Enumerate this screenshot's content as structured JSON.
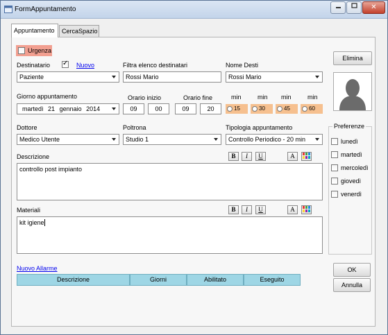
{
  "window": {
    "title": "FormAppuntamento"
  },
  "tabs": [
    "Appuntamento",
    "CercaSpazio"
  ],
  "urgenza": {
    "label": "Urgenza",
    "checked": false
  },
  "destinatario": {
    "label": "Destinatario",
    "checked": true,
    "nuovo": "Nuovo",
    "value": "Paziente"
  },
  "filtro": {
    "label": "Filtra elenco destinatari",
    "value": "Rossi Mario"
  },
  "nome_desti": {
    "label": "Nome Desti",
    "value": "Rossi Mario"
  },
  "giorno": {
    "label": "Giorno appuntamento",
    "day": "martedì",
    "date": "21",
    "month": "gennaio",
    "year": "2014"
  },
  "orario_inizio": {
    "label": "Orario inizio",
    "h": "09",
    "m": "00"
  },
  "orario_fine": {
    "label": "Orario fine",
    "h": "09",
    "m": "20"
  },
  "minutes": [
    {
      "label": "min",
      "value": "15"
    },
    {
      "label": "min",
      "value": "30"
    },
    {
      "label": "min",
      "value": "45"
    },
    {
      "label": "min",
      "value": "60"
    }
  ],
  "dottore": {
    "label": "Dottore",
    "value": "Medico Utente"
  },
  "poltrona": {
    "label": "Poltrona",
    "value": "Studio 1"
  },
  "tipologia": {
    "label": "Tipologia appuntamento",
    "value": "Controllo Periodico - 20 min"
  },
  "descrizione": {
    "label": "Descrizione",
    "value": "controllo post impianto"
  },
  "materiali": {
    "label": "Materiali",
    "value": "kit igiene"
  },
  "format": {
    "bold": "B",
    "italic": "I",
    "underline": "U",
    "font": "A"
  },
  "preferenze": {
    "title": "Preferenze",
    "days": [
      "lunedì",
      "martedì",
      "mercoledì",
      "giovedì",
      "venerdì"
    ]
  },
  "elimina": "Elimina",
  "ok": "OK",
  "annulla": "Annulla",
  "nuovo_allarme": "Nuovo Allarme",
  "alarm_columns": [
    "Descrizione",
    "Giorni",
    "Abilitato",
    "Eseguito"
  ],
  "colors": {
    "urgenza_bg": "#f29f90",
    "min_bg": "#f6c08f",
    "grid_header": "#9ed6e5"
  }
}
